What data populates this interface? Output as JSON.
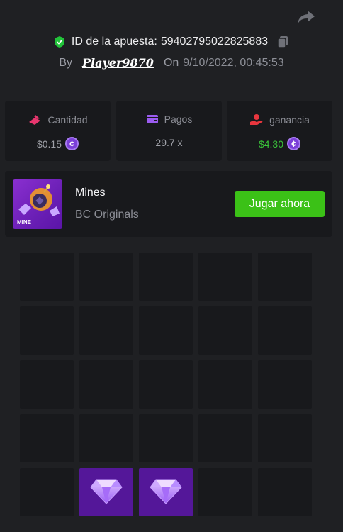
{
  "header": {
    "bet_id_label": "ID de la apuesta:",
    "bet_id_value": "59402795022825883",
    "by_label": "By",
    "player_name": "Player9870",
    "on_label": "On",
    "date": "9/10/2022, 00:45:53",
    "icons": [
      "share-icon",
      "shield-check-icon",
      "copy-icon"
    ]
  },
  "stats": {
    "amount": {
      "label": "Cantidad",
      "value": "$0.15",
      "icon": "bet-icon",
      "currency_icon": "coin-icon"
    },
    "payout": {
      "label": "Pagos",
      "value": "29.7 x",
      "icon": "wallet-icon"
    },
    "profit": {
      "label": "ganancia",
      "value": "$4.30",
      "icon": "profit-hand-icon",
      "currency_icon": "coin-icon"
    }
  },
  "game": {
    "name": "Mines",
    "provider": "BC Originals",
    "play_label": "Jugar ahora",
    "thumb_label": "MINE"
  },
  "board": {
    "rows": 5,
    "cols": 5,
    "tiles": [
      "empty",
      "empty",
      "empty",
      "empty",
      "empty",
      "empty",
      "empty",
      "empty",
      "empty",
      "empty",
      "empty",
      "empty",
      "empty",
      "empty",
      "empty",
      "empty",
      "empty",
      "empty",
      "empty",
      "empty",
      "empty",
      "gem",
      "gem",
      "empty",
      "empty"
    ]
  },
  "colors": {
    "background": "#1f2023",
    "card": "#18191c",
    "accent_green": "#3bc117",
    "gem_tile": "#541799",
    "coin": "#7b3fd8"
  }
}
